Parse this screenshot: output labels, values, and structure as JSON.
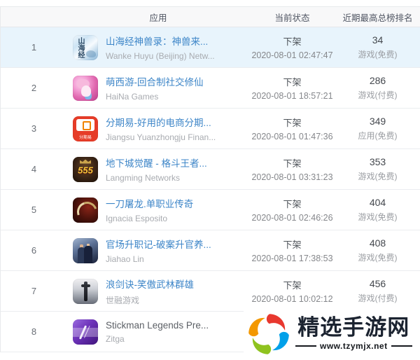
{
  "table": {
    "headers": {
      "rank": "",
      "app": "应用",
      "status": "当前状态",
      "top_rank": "近期最高总榜排名"
    },
    "rows": [
      {
        "rank": "1",
        "highlighted": true,
        "icon": "shanhaijing",
        "icon_text": "山海经",
        "name": "山海经神兽录：神兽来...",
        "is_link": true,
        "developer": "Wanke Huyu (Beijing) Netw...",
        "status": "下架",
        "status_date": "2020-08-01 02:47:47",
        "top_rank": "34",
        "top_category": "游戏(免费)"
      },
      {
        "rank": "2",
        "highlighted": false,
        "icon": "mengxiyou",
        "icon_text": "",
        "name": "萌西游-回合制社交修仙",
        "is_link": true,
        "developer": "HaiNa Games",
        "status": "下架",
        "status_date": "2020-08-01 18:57:21",
        "top_rank": "286",
        "top_category": "游戏(付费)"
      },
      {
        "rank": "3",
        "highlighted": false,
        "icon": "fenqiyi",
        "icon_text": "分期易",
        "name": "分期易-好用的电商分期...",
        "is_link": true,
        "developer": "Jiangsu Yuanzhongju Finan...",
        "status": "下架",
        "status_date": "2020-08-01 01:47:36",
        "top_rank": "349",
        "top_category": "应用(免费)"
      },
      {
        "rank": "4",
        "highlighted": false,
        "icon": "dixiacheng",
        "icon_text": "555",
        "name": "地下城觉醒 - 格斗王者...",
        "is_link": true,
        "developer": "Langming Networks",
        "status": "下架",
        "status_date": "2020-08-01 03:31:23",
        "top_rank": "353",
        "top_category": "游戏(免费)"
      },
      {
        "rank": "5",
        "highlighted": false,
        "icon": "yidaotulong",
        "icon_text": "",
        "name": "一刀屠龙.单职业传奇",
        "is_link": true,
        "developer": "Ignacia Esposito",
        "status": "下架",
        "status_date": "2020-08-01 02:46:26",
        "top_rank": "404",
        "top_category": "游戏(免费)"
      },
      {
        "rank": "6",
        "highlighted": false,
        "icon": "guanchang",
        "icon_text": "",
        "name": "官场升职记-破案升官养...",
        "is_link": true,
        "developer": "Jiahao Lin",
        "status": "下架",
        "status_date": "2020-08-01 17:38:53",
        "top_rank": "408",
        "top_category": "游戏(免费)"
      },
      {
        "rank": "7",
        "highlighted": false,
        "icon": "langjianjue",
        "icon_text": "",
        "name": "浪剑诀-笑傲武林群雄",
        "is_link": true,
        "developer": "世融游戏",
        "status": "下架",
        "status_date": "2020-08-01 10:02:12",
        "top_rank": "456",
        "top_category": "游戏(付费)"
      },
      {
        "rank": "8",
        "highlighted": false,
        "icon": "stickman",
        "icon_text": "",
        "name": "Stickman Legends Pre...",
        "is_link": false,
        "developer": "Zitga",
        "status": "",
        "status_date": "",
        "top_rank": "",
        "top_category": ""
      }
    ]
  },
  "watermark": {
    "title": "精选手游网",
    "url": "www.tzymjx.net",
    "colors": {
      "red": "#e8382f",
      "blue": "#00a0e9",
      "green": "#8fc31f",
      "orange": "#f39800"
    }
  },
  "colors": {
    "link_blue": "#3e86c8",
    "row_highlight": "#e8f4fc",
    "header_bg": "#f8f8f9"
  }
}
